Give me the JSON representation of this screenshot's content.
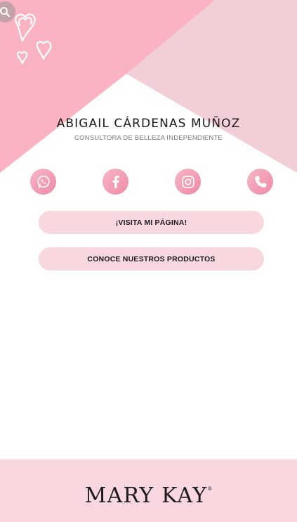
{
  "profile": {
    "name": "ABIGAIL CÁRDENAS MUÑOZ",
    "subtitle": "CONSULTORA DE BELLEZA INDEPENDIENTE"
  },
  "social": [
    {
      "icon": "whatsapp-icon"
    },
    {
      "icon": "facebook-icon"
    },
    {
      "icon": "instagram-icon"
    },
    {
      "icon": "phone-icon"
    }
  ],
  "buttons": {
    "visit": "¡VISITA MI PÁGINA!",
    "products": "CONOCE NUESTROS PRODUCTOS"
  },
  "footer": {
    "brand": "MARY KAY",
    "trademark": "®"
  },
  "colors": {
    "pink_main": "#fbb3c1",
    "pink_light": "#f2ced6",
    "button_bg": "#f9d7df",
    "footer_bg": "#f8d7df"
  }
}
